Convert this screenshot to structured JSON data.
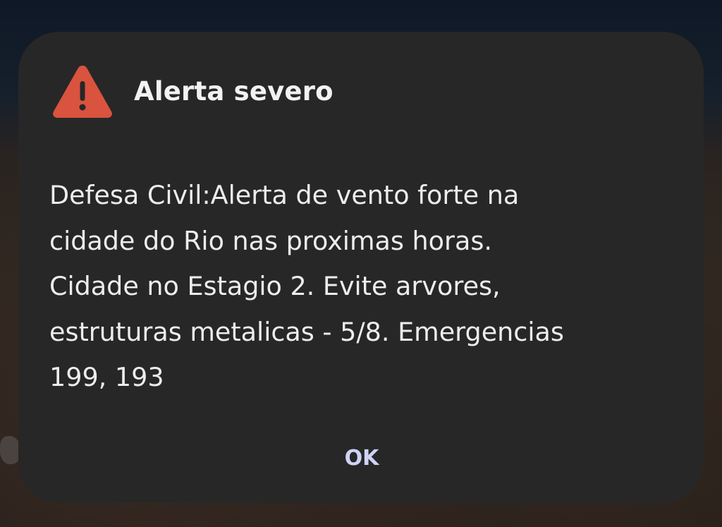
{
  "dialog": {
    "title": "Alerta severo",
    "icon": "warning-triangle-icon",
    "icon_color": "#d9533f",
    "message_lines": [
      "Defesa Civil:Alerta de vento forte na",
      "cidade do Rio nas proximas horas.",
      "Cidade no Estagio 2. Evite arvores,",
      "estruturas metalicas - 5/8. Emergencias",
      "199, 193"
    ],
    "ok_label": "OK"
  }
}
